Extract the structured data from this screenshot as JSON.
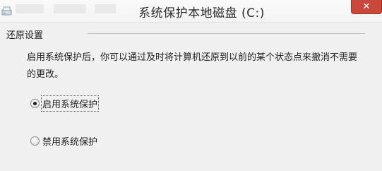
{
  "window": {
    "title": "系统保护本地磁盘 (C:)",
    "close_label": "✕"
  },
  "restore_settings": {
    "header": "还原设置",
    "description": "启用系统保护后，你可以通过及时将计算机还原到以前的某个状态点来撤消不需要的更改。",
    "options": [
      {
        "label": "启用系统保护",
        "selected": true
      },
      {
        "label": "禁用系统保护",
        "selected": false
      }
    ]
  },
  "icons": {
    "app": "system-protection-icon"
  }
}
